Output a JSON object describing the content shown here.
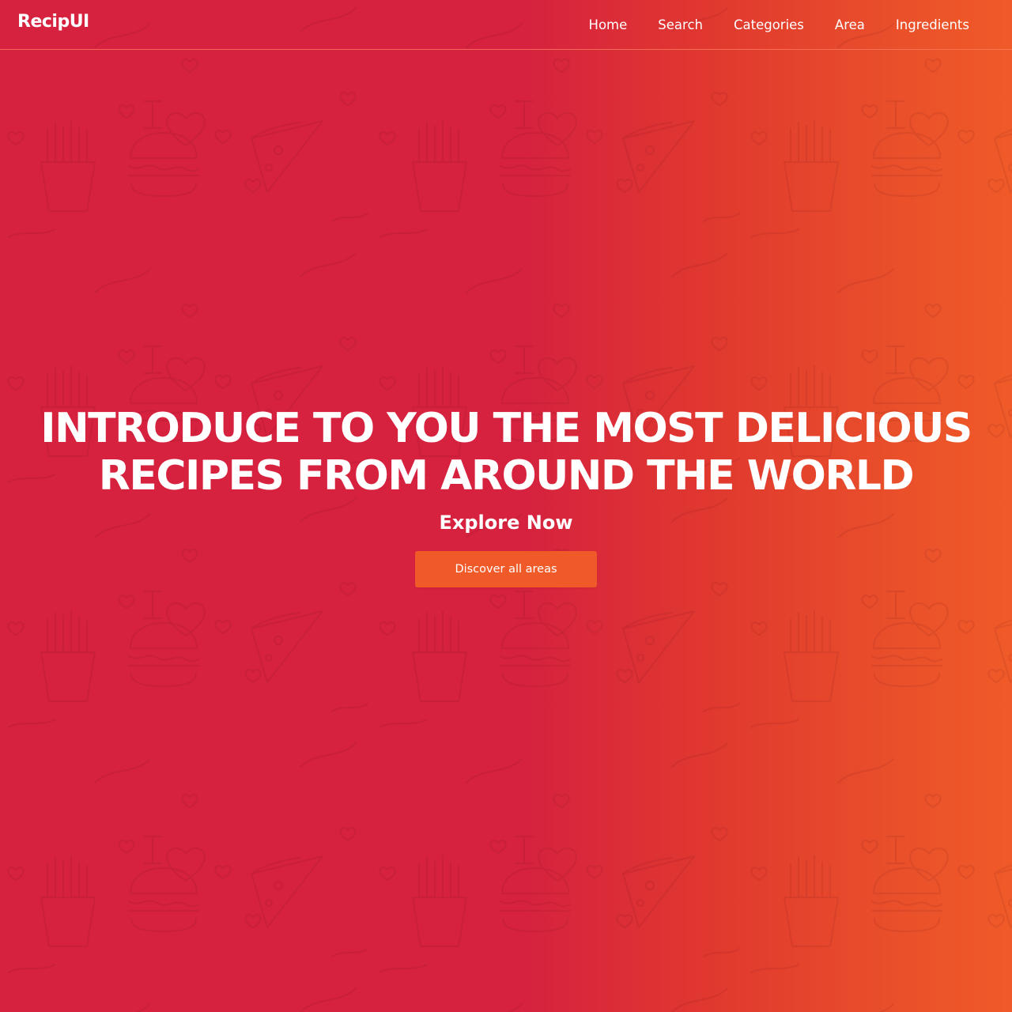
{
  "brand": {
    "name": "RecipUI"
  },
  "nav": {
    "items": [
      {
        "label": "Home"
      },
      {
        "label": "Search"
      },
      {
        "label": "Categories"
      },
      {
        "label": "Area"
      },
      {
        "label": "Ingredients"
      }
    ]
  },
  "hero": {
    "title_line1": "INTRODUCE TO YOU THE MOST DELICIOUS",
    "title_line2": "RECIPES FROM AROUND THE WORLD",
    "subtitle": "Explore Now",
    "cta_label": "Discover all areas"
  },
  "theme": {
    "background_start": "#d6223f",
    "background_end": "#f05a28",
    "button_color": "#f05a28",
    "text_color": "#ffffff"
  },
  "background_pattern": {
    "icons": [
      "french-fries-icon",
      "burger-icon",
      "pizza-slice-icon",
      "i-heart-icon",
      "heart-icon"
    ]
  }
}
